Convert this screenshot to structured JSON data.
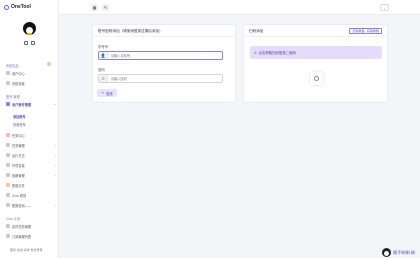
{
  "brand": {
    "name": "OneTool"
  },
  "sidebar": {
    "groups": [
      {
        "title": "系统信息"
      },
      {
        "title": "账号 管理"
      },
      {
        "title": "Cron 计划"
      }
    ],
    "items": [
      {
        "label": "用户中心"
      },
      {
        "label": "系统设置"
      },
      {
        "label": "用户账号管理"
      },
      {
        "label": "添加账号"
      },
      {
        "label": "查看账号"
      },
      {
        "label": "任务中心"
      },
      {
        "label": "任务管理"
      },
      {
        "label": "运行日志"
      },
      {
        "label": "环境变量"
      },
      {
        "label": "依赖管理"
      },
      {
        "label": "配置文件"
      },
      {
        "label": "Cron 规则"
      },
      {
        "label": "配置检测——"
      },
      {
        "label": "定时任务管理"
      },
      {
        "label": "订阅管理列表"
      }
    ],
    "footer": "服务 在线 请求 暂未登录"
  },
  "left_card": {
    "title": "账号密码添加（请使用登录过期后添加）",
    "account_label": "学号号",
    "account_placeholder": "请输入手机号",
    "password_label": "密码",
    "password_placeholder": "请输入密码",
    "login_label": "登录"
  },
  "right_card": {
    "title": "扫码添加",
    "tag_label": "扫码教程 - 获取教程",
    "banner_text": "点击获取扫码登录二维码"
  },
  "support": {
    "label": "随手刷刷 刷"
  },
  "colors": {
    "accent": "#5a48c6",
    "accent_light": "#e4dcf9"
  }
}
